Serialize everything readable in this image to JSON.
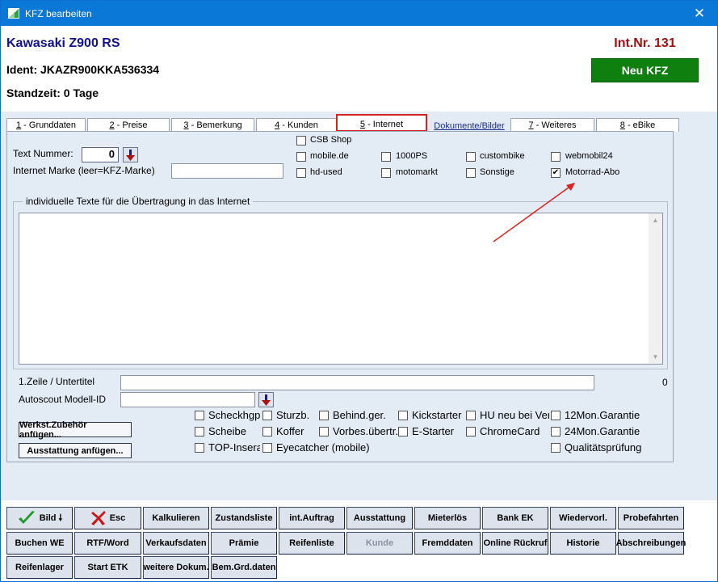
{
  "window": {
    "title": "KFZ bearbeiten",
    "close_glyph": "✕",
    "app_icon": "app-logo-icon"
  },
  "header": {
    "model": "Kawasaki Z900 RS",
    "ident": "Ident: JKAZR900KKA536334",
    "standzeit": "Standzeit: 0 Tage",
    "intnr": "Int.Nr. 131",
    "neu_kfz": "Neu KFZ"
  },
  "tabs": [
    {
      "num": "1",
      "label": " - Grunddaten"
    },
    {
      "num": "2",
      "label": " - Preise"
    },
    {
      "num": "3",
      "label": " - Bemerkung"
    },
    {
      "num": "4",
      "label": " - Kunden"
    },
    {
      "num": "5",
      "label": " - Internet"
    },
    {
      "label": "Dokumente/Bilder"
    },
    {
      "num": "7",
      "label": " - Weiteres"
    },
    {
      "num": "8",
      "label": " - eBike"
    }
  ],
  "form": {
    "text_nummer_label": "Text Nummer:",
    "text_nummer_value": "0",
    "marke_label": "Internet Marke (leer=KFZ-Marke)",
    "marke_value": ""
  },
  "portals": [
    {
      "label": "CSB Shop",
      "checked": false
    },
    {
      "label": "mobile.de",
      "checked": false
    },
    {
      "label": "1000PS",
      "checked": false
    },
    {
      "label": "custombike",
      "checked": false
    },
    {
      "label": "webmobil24",
      "checked": false
    },
    {
      "label": "hd-used",
      "checked": false
    },
    {
      "label": "motomarkt",
      "checked": false
    },
    {
      "label": "Sonstige",
      "checked": false
    },
    {
      "label": "Motorrad-Abo",
      "checked": true
    }
  ],
  "texts_group": {
    "legend": "individuelle Texte für die Übertragung in das Internet",
    "value": ""
  },
  "zeile": {
    "label": "1.Zeile / Untertitel",
    "value": "",
    "count": "0"
  },
  "autoscout": {
    "label": "Autoscout Modell-ID",
    "value": ""
  },
  "side_buttons": {
    "werkst": "Werkst.Zubehör anfügen...",
    "ausstattung": "Ausstattung anfügen..."
  },
  "features": [
    {
      "label": "Scheckhgpfl",
      "checked": false
    },
    {
      "label": "Sturzb.",
      "checked": false
    },
    {
      "label": "Behind.ger.",
      "checked": false
    },
    {
      "label": "Kickstarter",
      "checked": false
    },
    {
      "label": "HU neu bei Verk.",
      "checked": false
    },
    {
      "label": "12Mon.Garantie",
      "checked": false
    },
    {
      "label": "Scheibe",
      "checked": false
    },
    {
      "label": "Koffer",
      "checked": false
    },
    {
      "label": "Vorbes.übertr.",
      "checked": false
    },
    {
      "label": "E-Starter",
      "checked": false
    },
    {
      "label": "ChromeCard",
      "checked": false
    },
    {
      "label": "24Mon.Garantie",
      "checked": false
    },
    {
      "label": "TOP-Inserat",
      "checked": false
    },
    {
      "label": "Eyecatcher (mobile)",
      "checked": false
    },
    {
      "label": "Qualitätsprüfung",
      "checked": false
    }
  ],
  "toolbar": {
    "row1": [
      "Bild",
      "Esc",
      "Kalkulieren",
      "Zustandsliste",
      "int.Auftrag",
      "Ausstattung",
      "Mieterlös",
      "Bank EK",
      "Wiedervorl.",
      "Probefahrten"
    ],
    "row2": [
      "Buchen WE",
      "RTF/Word",
      "Verkaufsdaten",
      "Prämie",
      "Reifenliste",
      "Kunde",
      "Fremddaten",
      "Online Rückruf",
      "Historie",
      "Abschreibungen"
    ],
    "row3": [
      "Reifenlager",
      "Start ETK",
      "weitere Dokum.",
      "Bem.Grd.daten"
    ],
    "disabled": [
      "Kunde"
    ]
  },
  "colors": {
    "title_bar": "#0a78d7",
    "model_text": "#101090",
    "intnr_text": "#a01010",
    "neu_kfz_bg": "#0f7f0f",
    "highlight": "#d42020"
  }
}
